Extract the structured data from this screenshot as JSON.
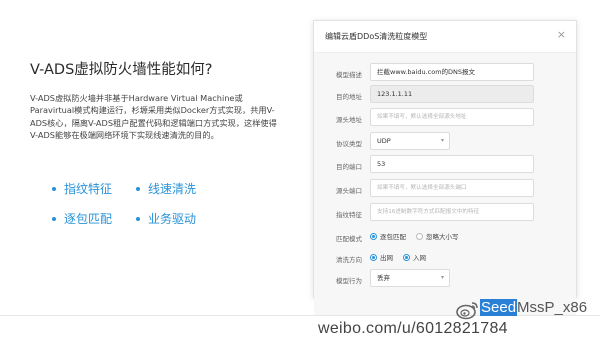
{
  "left": {
    "headline": "V-ADS虚拟防火墙性能如何?",
    "paragraph": "V-ADS虚拟防火墙并非基于Hardware Virtual Machine或Paravirtual模式构建运行，杉塬采用类似Docker方式实现，共用V-ADS核心，隔离V-ADS租户配置代码和逻辑端口方式实现，这样使得V-ADS能够在极端网络环境下实现线速清洗的目的。",
    "features": [
      "指纹特征",
      "线速清洗",
      "逐包匹配",
      "业务驱动"
    ]
  },
  "modal": {
    "title": "编辑云盾DDoS清洗粒度模型",
    "close": "×",
    "fields": {
      "model_desc": {
        "label": "模型描述",
        "value": "拦截www.baidu.com的DNS报文"
      },
      "dst_ip": {
        "label": "目的地址",
        "value": "123.1.1.11"
      },
      "src_ip": {
        "label": "源头地址",
        "placeholder": "如果不填写，默认选择全部源头地址"
      },
      "protocol": {
        "label": "协议类型",
        "value": "UDP"
      },
      "dst_port": {
        "label": "目的端口",
        "value": "53"
      },
      "src_port": {
        "label": "源头端口",
        "placeholder": "如果不填写，默认选择全部源头端口"
      },
      "fingerprint": {
        "label": "指纹特征",
        "placeholder": "支持16进制数字符方式匹配报文中的特征"
      },
      "match_mode": {
        "label": "匹配模式",
        "options": [
          "逐包匹配",
          "忽略大小写"
        ],
        "selected": "逐包匹配"
      },
      "direction": {
        "label": "清洗方向",
        "options": [
          "出网",
          "入网"
        ],
        "selected": "入网"
      },
      "action": {
        "label": "模型行为",
        "value": "丢弃"
      }
    }
  },
  "watermark": {
    "name_highlight": "Seed",
    "name_rest": "MssP_x86",
    "url": "weibo.com/u/6012821784"
  },
  "colors": {
    "accent": "#2a93d8",
    "disabled_bg": "#ececec"
  }
}
